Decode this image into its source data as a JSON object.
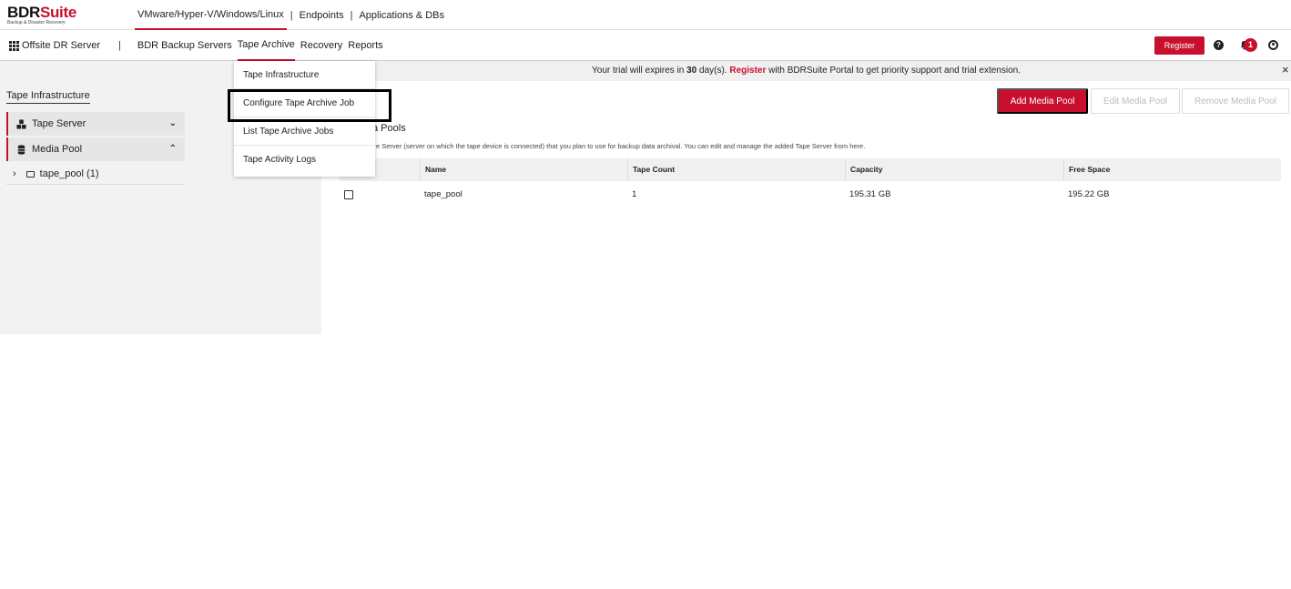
{
  "logo": {
    "name_part1": "BDR",
    "name_part2": "Suite",
    "tagline": "Backup & Disaster Recovery"
  },
  "top_nav": {
    "items": [
      "VMware/Hyper-V/Windows/Linux",
      "Endpoints",
      "Applications & DBs"
    ],
    "active": "VMware/Hyper-V/Windows/Linux",
    "separator": "|"
  },
  "sub_nav": {
    "home": "Offsite DR Server",
    "separator": "|",
    "items": [
      "BDR Backup Servers",
      "Tape Archive",
      "Recovery",
      "Reports"
    ],
    "active": "Tape Archive"
  },
  "header_actions": {
    "register": "Register",
    "notification_count": "1",
    "help_glyph": "?"
  },
  "trial_banner": {
    "prefix": "Your trial will expires in ",
    "days": "30",
    "unit": " day(s). ",
    "register": "Register",
    "suffix": " with BDRSuite Portal to get priority support and trial extension.",
    "close": "×"
  },
  "left_panel": {
    "title": "Tape Infrastructure",
    "items": [
      {
        "label": "Tape Server",
        "icon": "cubes-icon",
        "expanded": false
      },
      {
        "label": "Media Pool",
        "icon": "database-icon",
        "expanded": true
      }
    ],
    "child": {
      "label": "tape_pool (1)",
      "icon": "tape-icon"
    }
  },
  "dropdown": {
    "items": [
      "Tape Infrastructure",
      "Configure Tape Archive Job",
      "List Tape Archive Jobs",
      "Tape Activity Logs"
    ],
    "highlighted": "Configure Tape Archive Job"
  },
  "main": {
    "buttons": {
      "add": "Add Media Pool",
      "edit": "Edit Media Pool",
      "remove": "Remove Media Pool"
    },
    "section_title": "a Pools",
    "description": "e Server (server on which the tape device is connected) that you plan to use for backup data archival. You can edit and manage the added Tape Server from here.",
    "table": {
      "headers": [
        "Name",
        "Tape Count",
        "Capacity",
        "Free Space"
      ],
      "rows": [
        {
          "name": "tape_pool",
          "tape_count": "1",
          "capacity": "195.31 GB",
          "free_space": "195.22 GB"
        }
      ]
    }
  },
  "colors": {
    "accent": "#c8102e",
    "banner_bg": "#f0f0f0",
    "panel_bg": "#f2f2f2"
  }
}
